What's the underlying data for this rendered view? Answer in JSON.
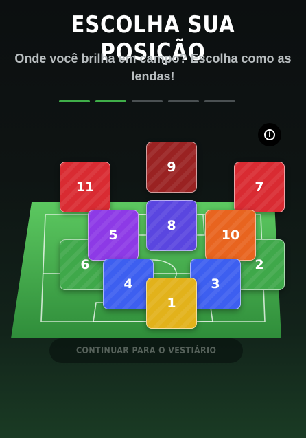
{
  "header": {
    "title": "ESCOLHA SUA POSIÇÃO",
    "subtitle": "Onde você brilha em campo? Escolha como as lendas!"
  },
  "progress": {
    "total_steps": 5,
    "completed_steps": 2
  },
  "info_icon": "info-icon",
  "positions": [
    {
      "number": "9",
      "color": "#9a2222"
    },
    {
      "number": "11",
      "color": "#d92b32"
    },
    {
      "number": "7",
      "color": "#d92b32"
    },
    {
      "number": "5",
      "color": "#8d3ae6"
    },
    {
      "number": "8",
      "color": "#5a46e0"
    },
    {
      "number": "10",
      "color": "#e8641f"
    },
    {
      "number": "6",
      "color": "#3fa84a"
    },
    {
      "number": "2",
      "color": "#3fa84a"
    },
    {
      "number": "4",
      "color": "#3d5ff0"
    },
    {
      "number": "3",
      "color": "#3d5ff0"
    },
    {
      "number": "1",
      "color": "#e2b21b"
    }
  ],
  "cta": {
    "label": "CONTINUAR PARA O VESTIÁRIO"
  }
}
